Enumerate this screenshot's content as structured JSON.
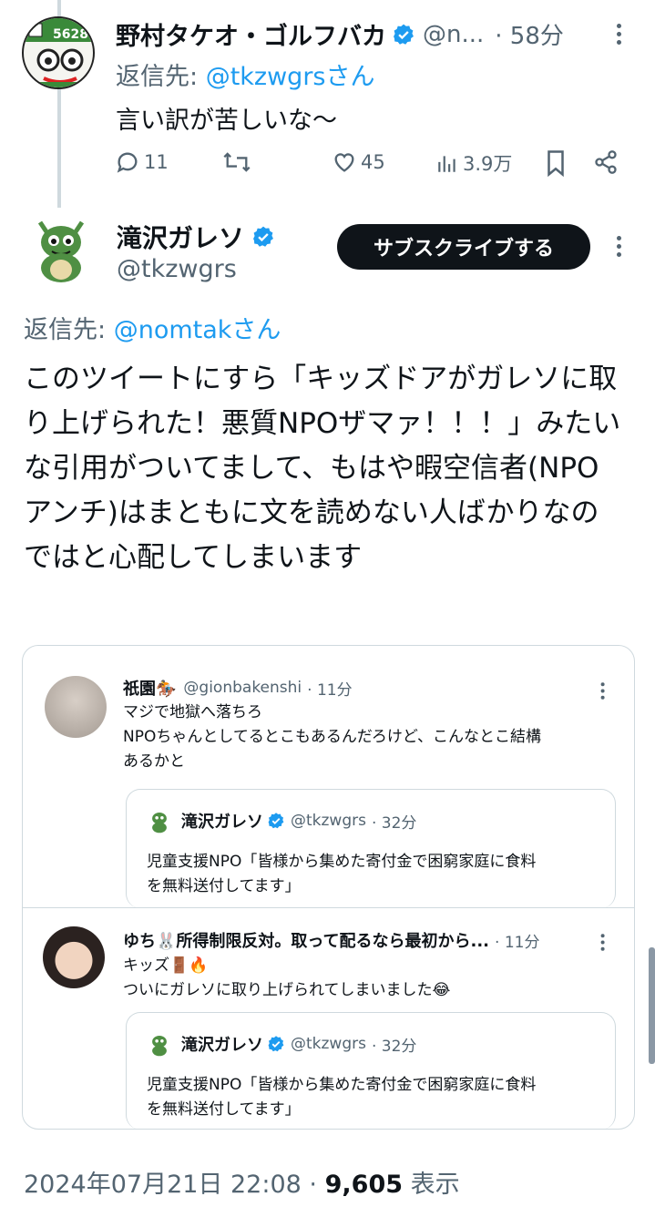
{
  "reply_tweet": {
    "display_name": "野村タケオ・ゴルフバカ",
    "handle": "@n...",
    "time": "· 58分",
    "reply_prefix": "返信先:",
    "reply_to": "@tkzwgrsさん",
    "text": "言い訳が苦しいな〜",
    "avatar_label": "5628",
    "actions": {
      "replies": "11",
      "likes": "45",
      "views": "3.9万"
    }
  },
  "main_tweet": {
    "display_name": "滝沢ガレソ",
    "handle": "@tkzwgrs",
    "subscribe_label": "サブスクライブする",
    "reply_prefix": "返信先:",
    "reply_to": "@nomtakさん",
    "text": "このツイートにすら「キッズドアがガレソに取り上げられた！悪質NPOザマァ！！！」みたいな引用がついてまして、もはや暇空信者(NPOアンチ)はまともに文を読めない人ばかりなのではと心配してしまいます",
    "timestamp": "2024年07月21日 22:08",
    "sep": "·",
    "views_count": "9,605",
    "views_label": "表示"
  },
  "quotes": [
    {
      "display_name": "祇園🏇",
      "handle": "@gionbakenshi",
      "time": "· 11分",
      "lines": [
        "マジで地獄へ落ちろ",
        "NPOちゃんとしてるとこもあるんだろけど、こんなとこ結構",
        "あるかと"
      ],
      "inner": {
        "display_name": "滝沢ガレソ",
        "handle": "@tkzwgrs",
        "time": "· 32分",
        "lines": [
          "児童支援NPO「皆様から集めた寄付金で困窮家庭に食料",
          "を無料送付してます」"
        ]
      }
    },
    {
      "display_name": "ゆち🐰所得制限反対。取って配るなら最初から...",
      "handle": "",
      "time": "· 11分",
      "lines": [
        "キッズ🚪🔥",
        "ついにガレソに取り上げられてしまいました😂"
      ],
      "inner": {
        "display_name": "滝沢ガレソ",
        "handle": "@tkzwgrs",
        "time": "· 32分",
        "lines": [
          "児童支援NPO「皆様から集めた寄付金で困窮家庭に食料",
          "を無料送付してます」"
        ]
      }
    }
  ],
  "colors": {
    "accent": "#1d9bf0",
    "text": "#0f1419",
    "muted": "#536471",
    "border": "#cfd9de",
    "dragon": "#4f8f43"
  }
}
